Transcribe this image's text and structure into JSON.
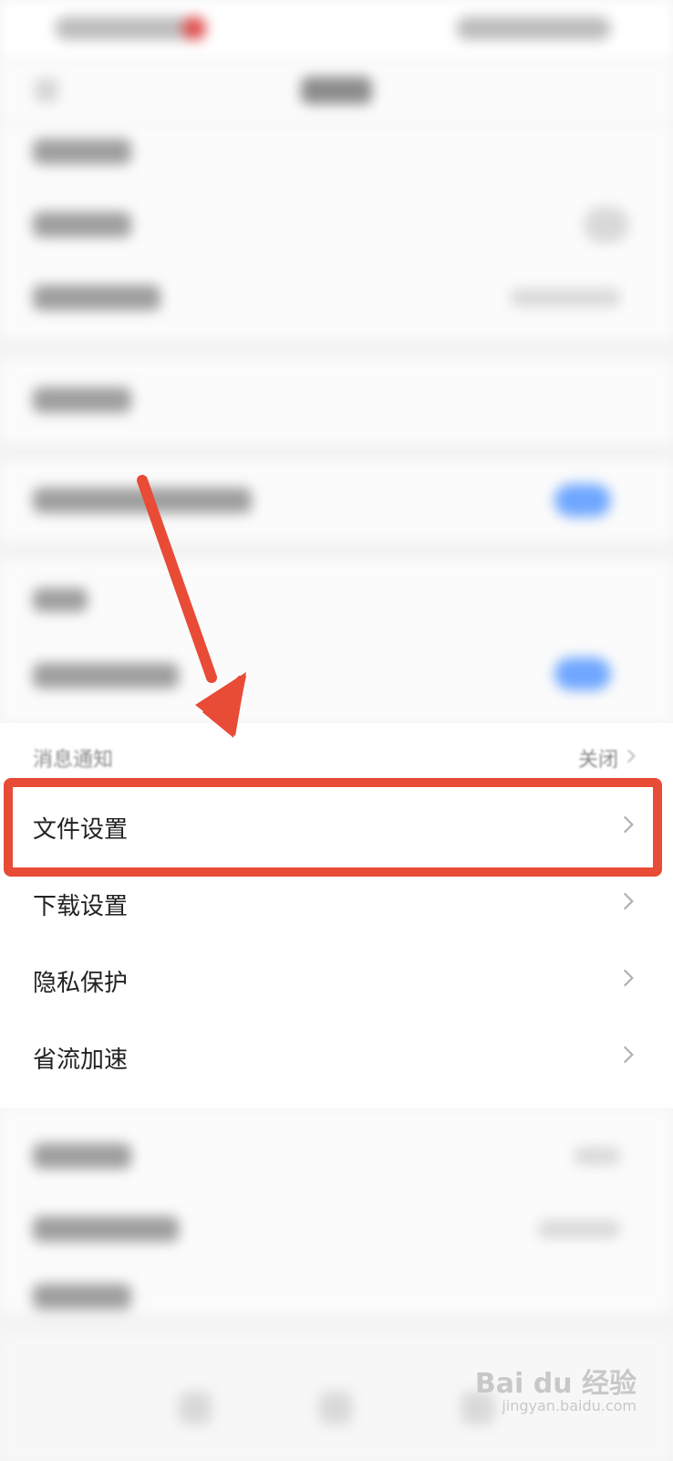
{
  "partial_row": {
    "title": "消息通知",
    "value": "关闭"
  },
  "menu": {
    "items": [
      {
        "label": "文件设置"
      },
      {
        "label": "下载设置"
      },
      {
        "label": "隐私保护"
      },
      {
        "label": "省流加速"
      }
    ]
  },
  "watermark": {
    "brand": "Bai du 经验",
    "url": "jingyan.baidu.com"
  },
  "colors": {
    "highlight": "#e84b36",
    "toggle_on": "#6fa7ff"
  }
}
